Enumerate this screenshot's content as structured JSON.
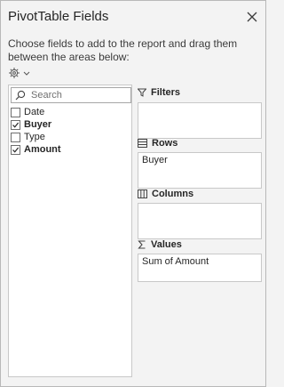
{
  "pane": {
    "title": "PivotTable Fields",
    "instructions": "Choose fields to add to the report and drag them between the areas below:"
  },
  "search": {
    "placeholder": "Search",
    "value": ""
  },
  "fields": [
    {
      "label": "Date",
      "checked": false
    },
    {
      "label": "Buyer",
      "checked": true
    },
    {
      "label": "Type",
      "checked": false
    },
    {
      "label": "Amount",
      "checked": true
    }
  ],
  "areas": {
    "filters": {
      "label": "Filters",
      "items": []
    },
    "rows": {
      "label": "Rows",
      "items": [
        "Buyer"
      ]
    },
    "columns": {
      "label": "Columns",
      "items": []
    },
    "values": {
      "label": "Values",
      "items": [
        "Sum of Amount"
      ]
    }
  },
  "icons": {
    "close": "close-icon",
    "tools": "gear-icon",
    "tools_dropdown": "chevron-down-icon",
    "search": "search-icon",
    "filters": "funnel-icon",
    "rows": "rows-icon",
    "columns": "columns-icon",
    "values": "sigma-icon"
  }
}
